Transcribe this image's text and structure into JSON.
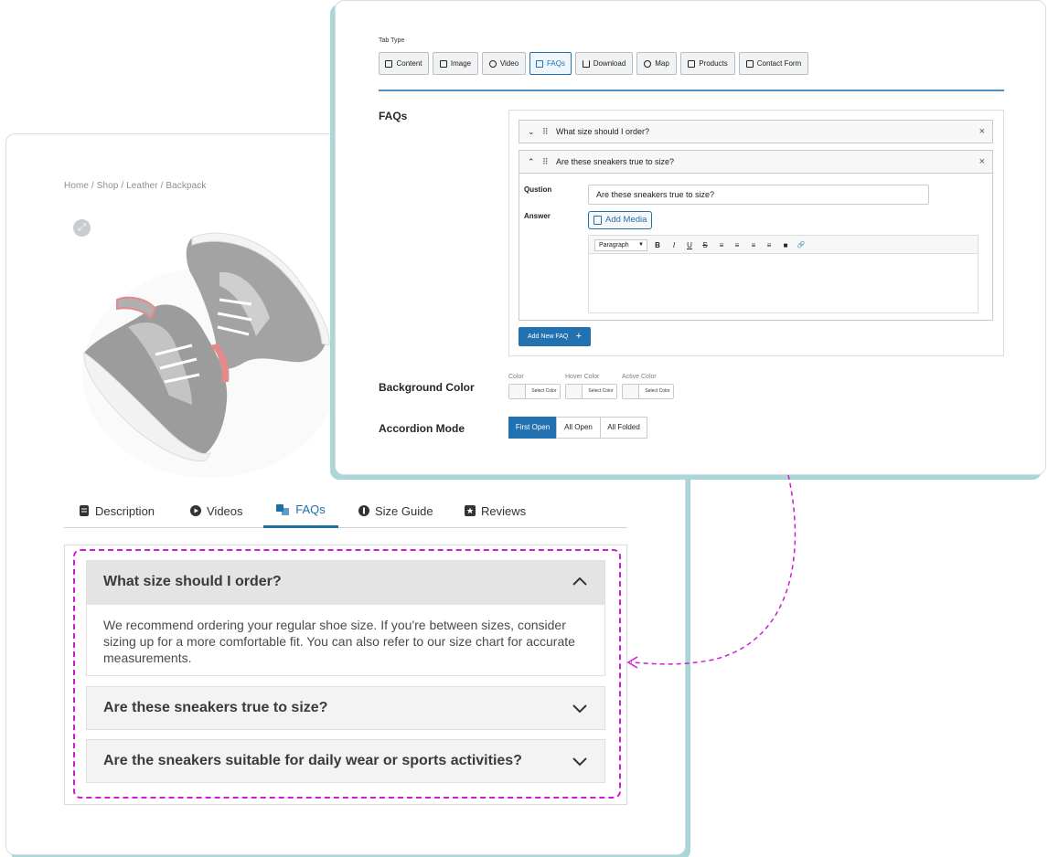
{
  "product_page": {
    "breadcrumb": "Home / Shop / Leather / Backpack",
    "tabs": [
      {
        "label": "Description",
        "icon": "document-icon"
      },
      {
        "label": "Videos",
        "icon": "play-icon"
      },
      {
        "label": "FAQs",
        "icon": "faq-icon",
        "active": true
      },
      {
        "label": "Size Guide",
        "icon": "info-icon"
      },
      {
        "label": "Reviews",
        "icon": "star-icon"
      }
    ],
    "faqs": [
      {
        "question": "What size should I order?",
        "expanded": true,
        "answer": "We recommend ordering your regular shoe size. If you're between sizes, consider sizing up for a more comfortable fit. You can also refer to our size chart for accurate measurements."
      },
      {
        "question": "Are these sneakers true to size?",
        "expanded": false
      },
      {
        "question": "Are the sneakers suitable for daily wear or sports activities?",
        "expanded": false
      }
    ]
  },
  "admin": {
    "tab_type_label": "Tab Type",
    "tab_types": [
      "Content",
      "Image",
      "Video",
      "FAQs",
      "Download",
      "Map",
      "Products",
      "Contact Form"
    ],
    "active_tab_type": "FAQs",
    "faqs_label": "FAQs",
    "faq_items": [
      {
        "title": "What size should I order?",
        "collapsed": true
      },
      {
        "title": "Are these sneakers true to size?",
        "collapsed": false
      }
    ],
    "question_label": "Qustion",
    "question_value": "Are these sneakers true to size?",
    "answer_label": "Answer",
    "add_media_label": "Add Media",
    "format_select": "Paragraph",
    "toolbar_buttons": [
      "B",
      "I",
      "U",
      "S",
      "≡",
      "≡",
      "≡",
      "≡",
      "■",
      "🔗"
    ],
    "add_faq_label": "Add New FAQ",
    "background_color_label": "Background Color",
    "color_pickers": [
      {
        "label": "Color",
        "button": "Select Color"
      },
      {
        "label": "Hover Color",
        "button": "Select Color"
      },
      {
        "label": "Active Color",
        "button": "Select Color"
      }
    ],
    "accordion_mode_label": "Accordion Mode",
    "accordion_modes": [
      "First Open",
      "All Open",
      "All Folded"
    ],
    "active_mode": "First Open"
  },
  "colors": {
    "accent": "#2271b1",
    "frontend_accent": "#1b70a8",
    "highlight_dash": "#d11ad1",
    "card_shadow": "#a9d6d6"
  }
}
